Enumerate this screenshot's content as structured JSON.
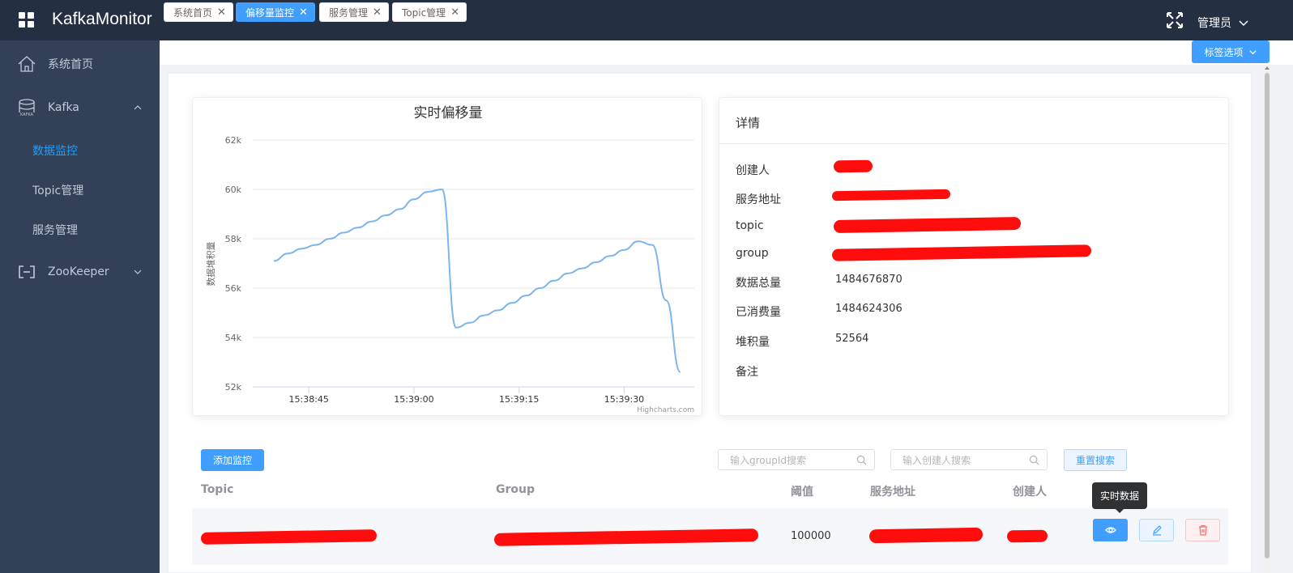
{
  "header": {
    "app_title": "KafkaMonitor",
    "user_label": "管理员"
  },
  "sidebar": {
    "home": "系统首页",
    "kafka": "Kafka",
    "kafka_children": [
      "数据监控",
      "Topic管理",
      "服务管理"
    ],
    "zookeeper": "ZooKeeper",
    "active_child": "数据监控"
  },
  "tabs": [
    {
      "label": "系统首页",
      "active": false
    },
    {
      "label": "偏移量监控",
      "active": true
    },
    {
      "label": "服务管理",
      "active": false
    },
    {
      "label": "Topic管理",
      "active": false
    }
  ],
  "tag_options_label": "标签选项",
  "chart_data": {
    "type": "line",
    "title": "实时偏移量",
    "ylabel": "数据堆积量",
    "xlabel": "",
    "ylim": [
      52000,
      62000
    ],
    "yticks": [
      "52k",
      "54k",
      "56k",
      "58k",
      "60k",
      "62k"
    ],
    "xticks": [
      "15:38:45",
      "15:39:00",
      "15:39:15",
      "15:39:30"
    ],
    "credit": "Highcharts.com",
    "series": [
      {
        "name": "",
        "x": [
          "15:38:40",
          "15:38:42",
          "15:38:44",
          "15:38:46",
          "15:38:48",
          "15:38:50",
          "15:38:52",
          "15:38:54",
          "15:38:56",
          "15:38:58",
          "15:39:00",
          "15:39:02",
          "15:39:04",
          "15:39:06",
          "15:39:08",
          "15:39:10",
          "15:39:12",
          "15:39:14",
          "15:39:16",
          "15:39:18",
          "15:39:20",
          "15:39:22",
          "15:39:24",
          "15:39:26",
          "15:39:28",
          "15:39:30",
          "15:39:32",
          "15:39:34",
          "15:39:36",
          "15:39:38"
        ],
        "values": [
          57100,
          57400,
          57600,
          57750,
          58000,
          58250,
          58450,
          58700,
          58950,
          59200,
          59600,
          59900,
          60000,
          54400,
          54600,
          54900,
          55100,
          55400,
          55700,
          56000,
          56300,
          56600,
          56800,
          57050,
          57300,
          57550,
          57900,
          57750,
          55500,
          52600
        ]
      }
    ]
  },
  "detail": {
    "title": "详情",
    "rows": [
      {
        "label": "创建人",
        "value": ""
      },
      {
        "label": "服务地址",
        "value": ""
      },
      {
        "label": "topic",
        "value": ""
      },
      {
        "label": "group",
        "value": ""
      },
      {
        "label": "数据总量",
        "value": "1484676870"
      },
      {
        "label": "已消费量",
        "value": "1484624306"
      },
      {
        "label": "堆积量",
        "value": "52564"
      },
      {
        "label": "备注",
        "value": ""
      }
    ]
  },
  "controls": {
    "add_button": "添加监控",
    "group_search_placeholder": "输入groupId搜索",
    "creator_search_placeholder": "输入创建人搜索",
    "reset_button": "重置搜索"
  },
  "table": {
    "headers": [
      "Topic",
      "Group",
      "阈值",
      "服务地址",
      "创建人"
    ],
    "rows": [
      {
        "topic": "",
        "group": "",
        "threshold": "100000",
        "address": "",
        "creator": ""
      }
    ],
    "tooltip": "实时数据"
  },
  "colors": {
    "header_bg": "#242f42",
    "sidebar_bg": "#324157",
    "primary": "#409eff",
    "chart_line": "#7cb5ec",
    "danger": "#f56c6c"
  }
}
